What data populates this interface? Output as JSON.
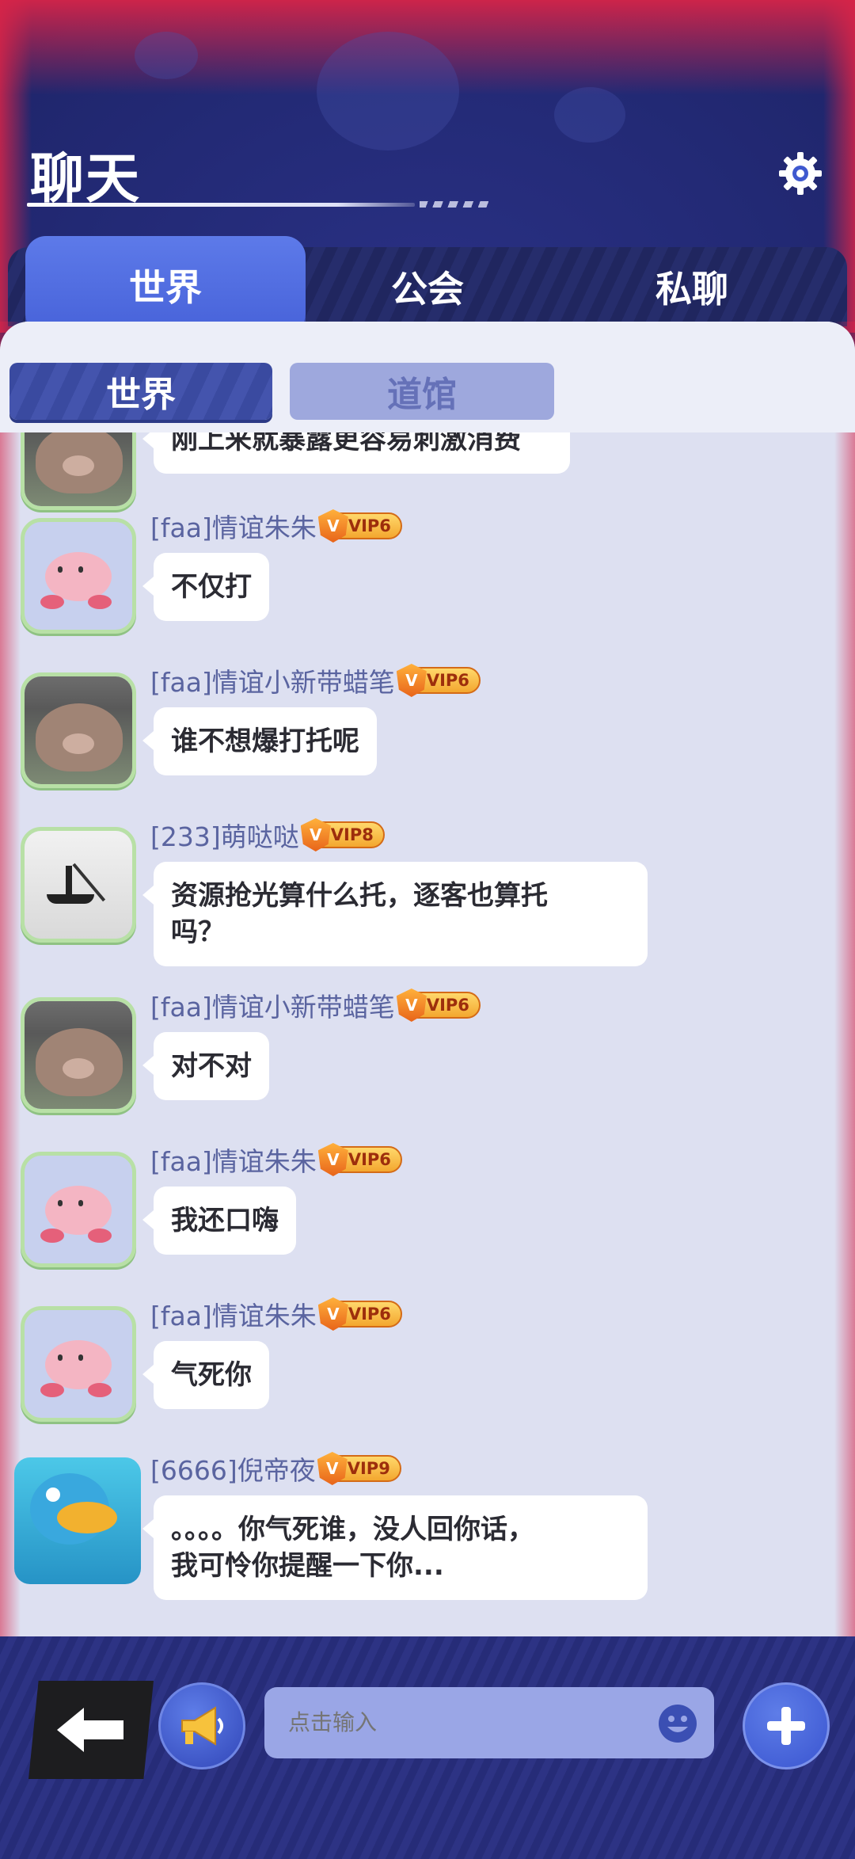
{
  "header": {
    "title": "聊天"
  },
  "tabs": [
    {
      "label": "世界",
      "active": true
    },
    {
      "label": "公会",
      "active": false
    },
    {
      "label": "私聊",
      "active": false
    }
  ],
  "subtabs": [
    {
      "label": "世界",
      "active": true
    },
    {
      "label": "道馆",
      "active": false
    }
  ],
  "messages": [
    {
      "sender": "",
      "vip": "",
      "text": "刚上来就暴露更容易刺激消费",
      "avatar": "bear-icon"
    },
    {
      "sender": "[faa]情谊朱朱",
      "vip": "VIP6",
      "text": "不仅打",
      "avatar": "pink-blob-icon"
    },
    {
      "sender": "[faa]情谊小新带蜡笔",
      "vip": "VIP6",
      "text": "谁不想爆打托呢",
      "avatar": "bear-icon"
    },
    {
      "sender": "[233]萌哒哒",
      "vip": "VIP8",
      "text_lines": [
        "资源抢光算什么托，逐客也算托",
        "吗？"
      ],
      "avatar": "boat-icon"
    },
    {
      "sender": "[faa]情谊小新带蜡笔",
      "vip": "VIP6",
      "text": "对不对",
      "avatar": "bear-icon"
    },
    {
      "sender": "[faa]情谊朱朱",
      "vip": "VIP6",
      "text": "我还口嗨",
      "avatar": "pink-blob-icon"
    },
    {
      "sender": "[faa]情谊朱朱",
      "vip": "VIP6",
      "text": "气死你",
      "avatar": "pink-blob-icon"
    },
    {
      "sender": "[6666]倪帝夜",
      "vip": "VIP9",
      "text_lines": [
        "。。。。你气死谁，没人回你话，",
        "我可怜你提醒一下你..."
      ],
      "avatar": "duck-icon"
    }
  ],
  "vip_letter": "V",
  "input": {
    "placeholder": "点击输入"
  },
  "icons": {
    "settings": "gear-icon",
    "back": "back-arrow-icon",
    "horn": "megaphone-icon",
    "emoji": "smile-icon",
    "plus": "plus-icon"
  },
  "colors": {
    "accent": "#4762d9",
    "panel": "#dde0f1",
    "header": "#232a76"
  }
}
